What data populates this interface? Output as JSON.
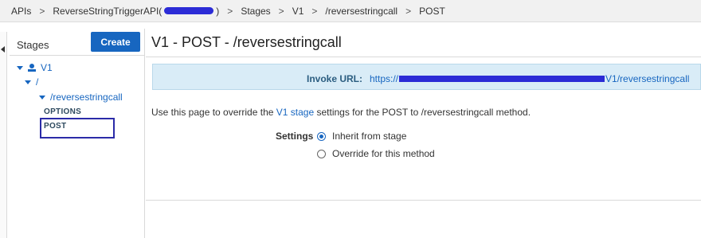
{
  "breadcrumb": {
    "items": [
      "APIs",
      "ReverseStringTriggerAPI",
      "Stages",
      "V1",
      "/reversestringcall",
      "POST"
    ],
    "separator": ">",
    "paren_open": "(",
    "paren_close": ")"
  },
  "sidebar": {
    "title": "Stages",
    "create_label": "Create",
    "tree": {
      "stage": "V1",
      "root": "/",
      "resource": "/reversestringcall",
      "methods": [
        "OPTIONS",
        "POST"
      ]
    }
  },
  "main": {
    "title": "V1 - POST - /reversestringcall",
    "invoke_label": "Invoke URL:",
    "invoke_url_prefix": "https://",
    "invoke_url_suffix": "V1/reversestringcall",
    "description_before": "Use this page to override the ",
    "description_link": "V1 stage",
    "description_after": " settings for the POST to /reversestringcall method.",
    "settings_label": "Settings",
    "options": [
      {
        "label": "Inherit from stage",
        "selected": true
      },
      {
        "label": "Override for this method",
        "selected": false
      }
    ]
  },
  "colors": {
    "accent": "#1766c0",
    "invoke_bg": "#d9ecf7",
    "highlight_box": "#2b2ba8"
  }
}
